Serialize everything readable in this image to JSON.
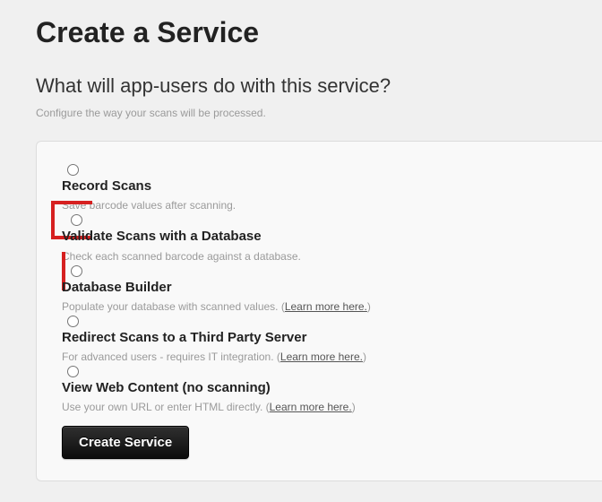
{
  "header": {
    "title": "Create a Service",
    "question": "What will app-users do with this service?",
    "hint": "Configure the way your scans will be processed."
  },
  "options": [
    {
      "title": "Record Scans",
      "desc": "Save barcode values after scanning.",
      "learn_more": null,
      "highlight": false
    },
    {
      "title": "Validate Scans with a Database",
      "desc": "Check each scanned barcode against a database.",
      "learn_more": null,
      "highlight": true
    },
    {
      "title": "Database Builder",
      "desc": "Populate your database with scanned values. ",
      "learn_more": "Learn more here.",
      "highlight": false
    },
    {
      "title": "Redirect Scans to a Third Party Server",
      "desc": "For advanced users - requires IT integration. ",
      "learn_more": "Learn more here.",
      "highlight": false
    },
    {
      "title": "View Web Content (no scanning)",
      "desc": "Use your own URL or enter HTML directly. ",
      "learn_more": "Learn more here.",
      "highlight": false
    }
  ],
  "submit": {
    "label": "Create Service"
  }
}
